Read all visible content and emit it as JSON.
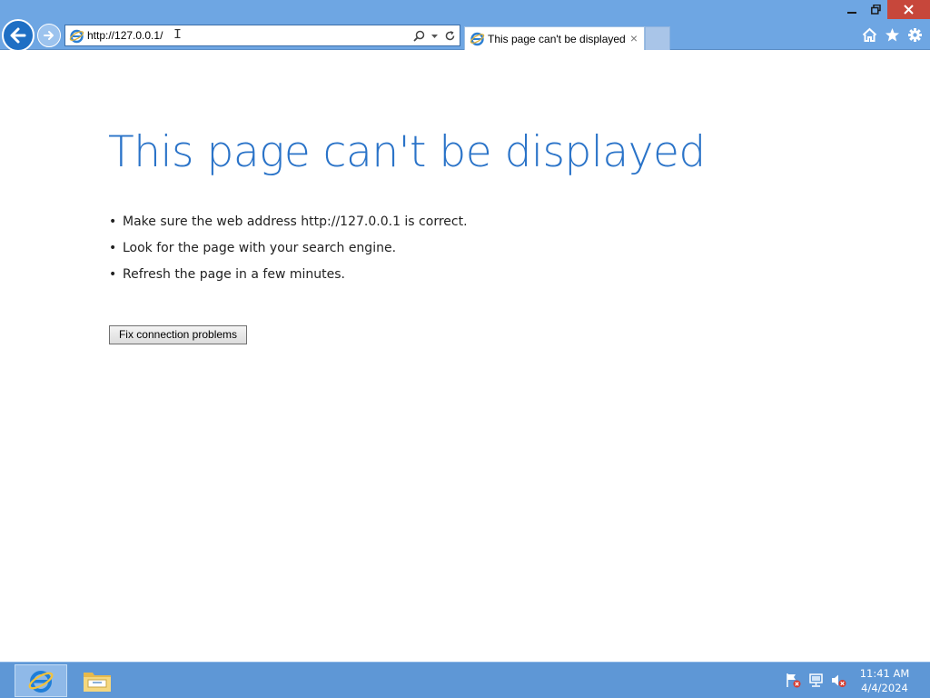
{
  "window": {
    "minimize_icon": "minimize-icon",
    "restore_icon": "restore-icon",
    "close_icon": "close-icon",
    "close_color": "#c7473b"
  },
  "navigation": {
    "back_icon": "back-arrow-icon",
    "forward_icon": "forward-arrow-icon"
  },
  "address_bar": {
    "value": "http://127.0.0.1/",
    "cursor_glyph": "I",
    "tools": [
      "search-icon",
      "dropdown-arrow-icon",
      "refresh-icon"
    ]
  },
  "tabs": [
    {
      "title": "This page can't be displayed",
      "close_glyph": "×",
      "active": true
    }
  ],
  "commands": [
    "home-icon",
    "favorites-star-icon",
    "settings-gear-icon"
  ],
  "page": {
    "heading": "This page can't be displayed",
    "suggestions": [
      "Make sure the web address http://127.0.0.1 is correct.",
      "Look for the page with your search engine.",
      "Refresh the page in a few minutes."
    ],
    "fix_button_label": "Fix connection problems",
    "heading_color": "#2a73c8"
  },
  "taskbar": {
    "apps": [
      "internet-explorer-icon",
      "file-explorer-icon"
    ],
    "tray_icons": [
      "action-center-flag-icon",
      "network-icon",
      "speaker-muted-icon"
    ],
    "time": "11:41 AM",
    "date": "4/4/2024",
    "color": "#5e97d6"
  }
}
